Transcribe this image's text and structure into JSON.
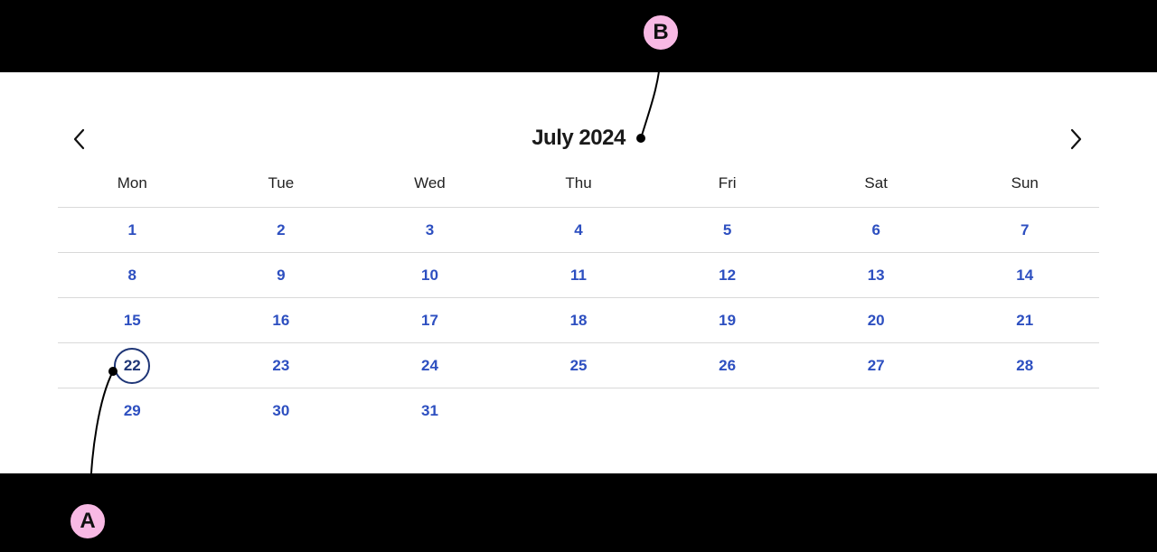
{
  "calendar": {
    "title": "July 2024",
    "prev_icon": "chevron-left-icon",
    "next_icon": "chevron-right-icon",
    "weekdays": [
      "Mon",
      "Tue",
      "Wed",
      "Thu",
      "Fri",
      "Sat",
      "Sun"
    ],
    "weeks": [
      [
        "1",
        "2",
        "3",
        "4",
        "5",
        "6",
        "7"
      ],
      [
        "8",
        "9",
        "10",
        "11",
        "12",
        "13",
        "14"
      ],
      [
        "15",
        "16",
        "17",
        "18",
        "19",
        "20",
        "21"
      ],
      [
        "22",
        "23",
        "24",
        "25",
        "26",
        "27",
        "28"
      ],
      [
        "29",
        "30",
        "31",
        "",
        "",
        "",
        ""
      ]
    ],
    "today": "22",
    "colors": {
      "day_text": "#2d4fc0",
      "today_ring": "#1e3576",
      "marker_fill": "#f8b9e4"
    }
  },
  "annotations": {
    "a_label": "A",
    "b_label": "B"
  }
}
